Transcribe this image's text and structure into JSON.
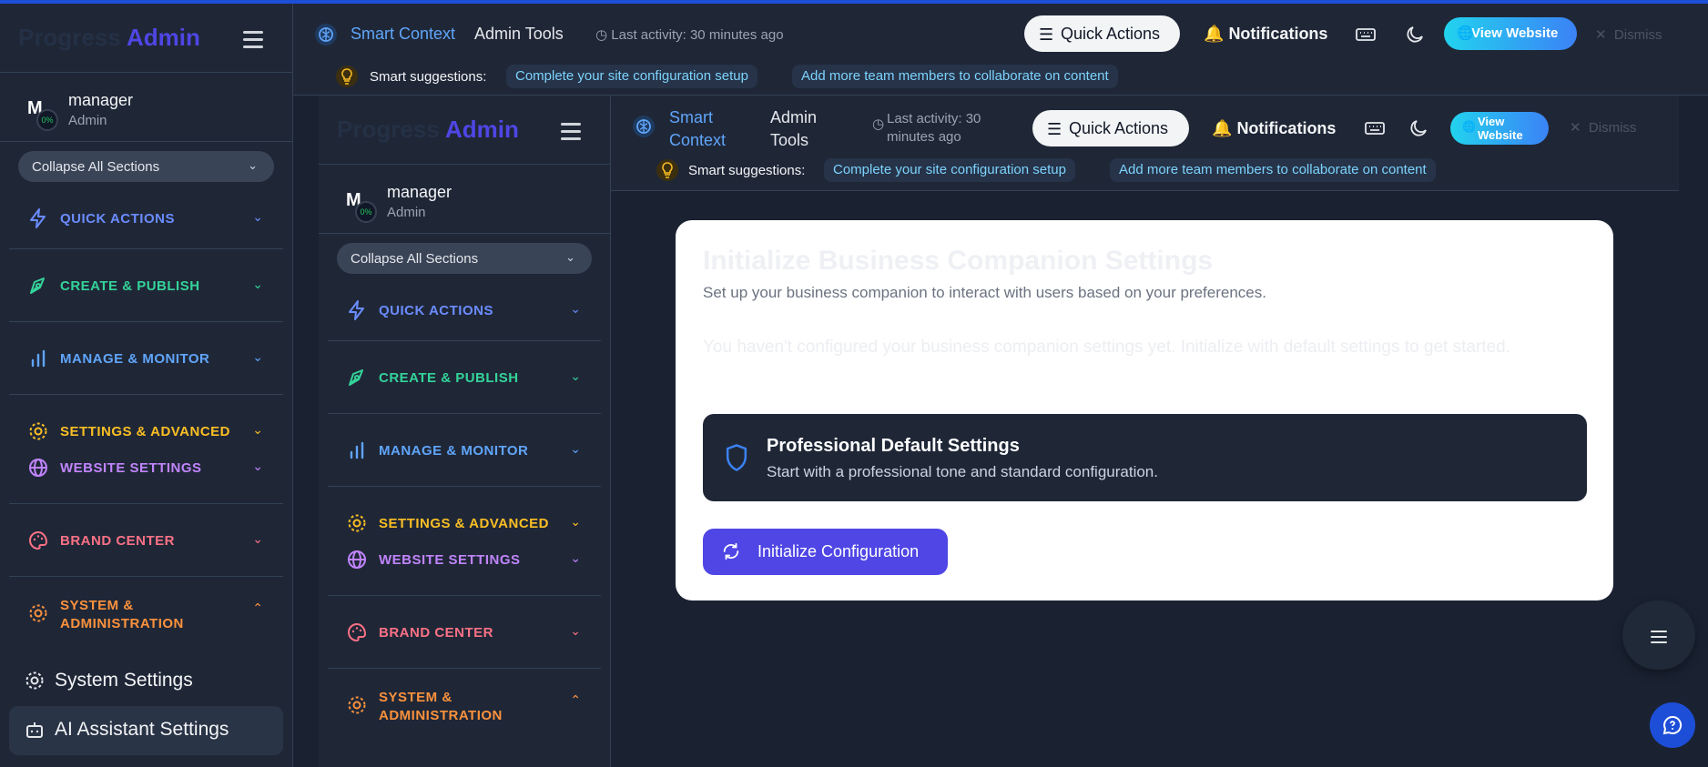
{
  "brand": {
    "progress": "Progress",
    "admin": "Admin"
  },
  "user": {
    "initial": "M",
    "percent": "0%",
    "name": "manager",
    "role": "Admin"
  },
  "sidebar": {
    "collapse_label": "Collapse All Sections",
    "sections": [
      {
        "label": "QUICK ACTIONS",
        "color": "#6b8cff"
      },
      {
        "label": "CREATE & PUBLISH",
        "color": "#34d399"
      },
      {
        "label": "MANAGE & MONITOR",
        "color": "#60a5fa"
      },
      {
        "label": "SETTINGS & ADVANCED",
        "color": "#fbbf24"
      },
      {
        "label": "WEBSITE SETTINGS",
        "color": "#c084fc"
      },
      {
        "label": "BRAND CENTER",
        "color": "#fb7185"
      },
      {
        "label": "SYSTEM &",
        "label2": "ADMINISTRATION",
        "color": "#fb923c"
      }
    ],
    "sub_items": [
      {
        "label": "System Settings"
      },
      {
        "label": "AI Assistant Settings"
      }
    ]
  },
  "topbar": {
    "context": "Smart Context",
    "context_line1": "Smart",
    "context_line2": "Context",
    "tools": "Admin Tools",
    "tools_line1": "Admin",
    "tools_line2": "Tools",
    "last_activity": "Last activity: 30 minutes ago",
    "last_activity_line1": "Last activity: 30",
    "last_activity_line2": "minutes ago",
    "quick_actions": "Quick Actions",
    "notifications": "Notifications",
    "view_website": "View Website",
    "view_line1": "View",
    "view_line2": "Website",
    "dismiss": "Dismiss",
    "suggestions_label": "Smart suggestions:",
    "suggestions": [
      "Complete your site configuration setup",
      "Add more team members to collaborate on content"
    ]
  },
  "card": {
    "title": "Initialize Business Companion Settings",
    "subtitle": "Set up your business companion to interact with users based on your preferences.",
    "note": "You haven't configured your business companion settings yet. Initialize with default settings to get started.",
    "default_title": "Professional Default Settings",
    "default_desc": "Start with a professional tone and standard configuration.",
    "init_button": "Initialize Configuration"
  }
}
